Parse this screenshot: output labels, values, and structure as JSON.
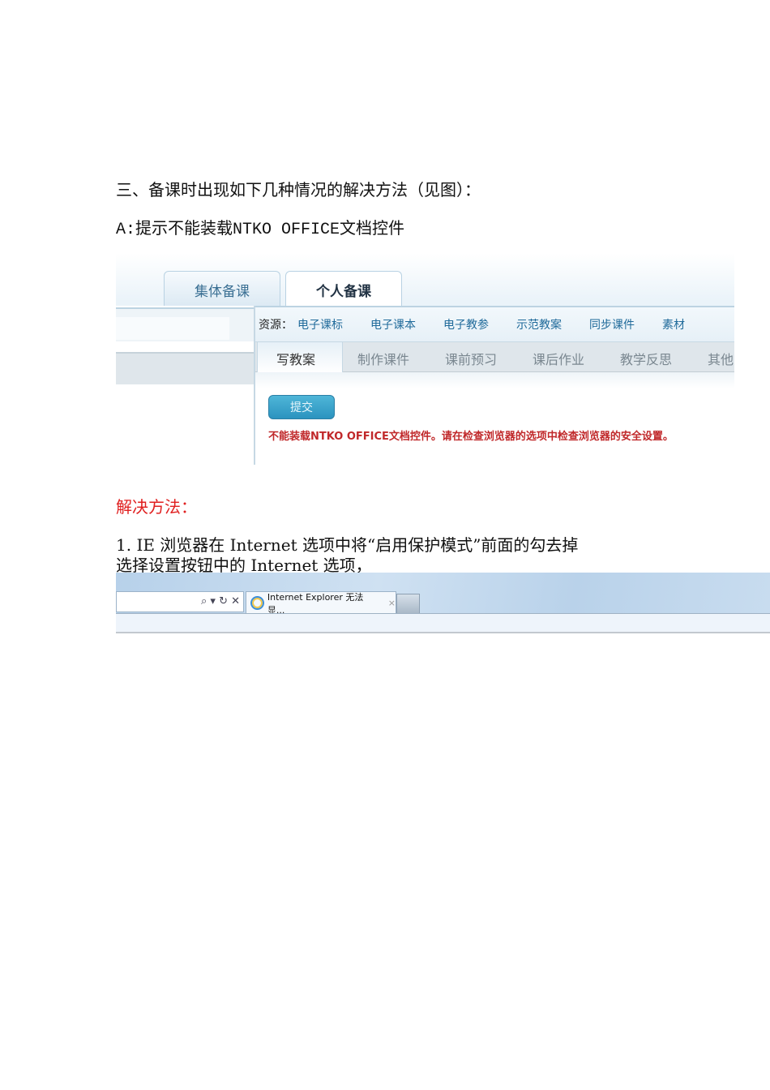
{
  "heading": "三、备课时出现如下几种情况的解决方法（见图）：",
  "case_a": "A:提示不能装载NTKO OFFICE文档控件",
  "screenshot1": {
    "tabs": [
      "集体备课",
      "个人备课"
    ],
    "resources_label": "资源：",
    "resources": [
      "电子课标",
      "电子课本",
      "电子教参",
      "示范教案",
      "同步课件",
      "素材"
    ],
    "subtabs": [
      "写教案",
      "制作课件",
      "课前预习",
      "课后作业",
      "教学反思",
      "其他"
    ],
    "submit_button": "提交",
    "error_message": "不能装载NTKO OFFICE文档控件。请在检查浏览器的选项中检查浏览器的安全设置。"
  },
  "solution_label": "解决方法：",
  "step1_line1": "1. IE 浏览器在 Internet 选项中将“启用保护模式”前面的勾去掉",
  "step1_line2": "选择设置按钮中的 Internet 选项，",
  "screenshot2": {
    "address_icons": "⌕ ▾ ↻ ✕",
    "tab_title": "Internet Explorer 无法显...",
    "tab_close": "×"
  }
}
